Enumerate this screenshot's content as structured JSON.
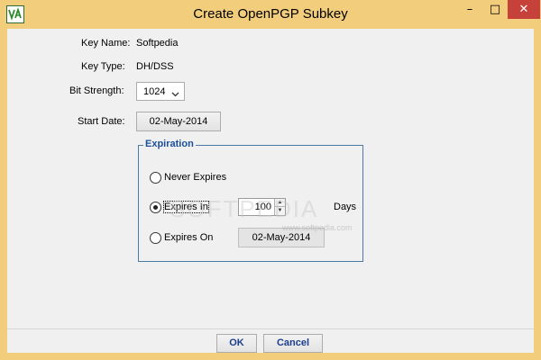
{
  "window": {
    "title": "Create OpenPGP Subkey",
    "minimize_glyph": "–",
    "maximize_glyph": "□",
    "close_glyph": "✕"
  },
  "form": {
    "key_name_label": "Key Name:",
    "key_name_value": "Softpedia",
    "key_type_label": "Key Type:",
    "key_type_value": "DH/DSS",
    "bit_strength_label": "Bit Strength:",
    "bit_strength_value": "1024",
    "start_date_label": "Start Date:",
    "start_date_value": "02-May-2014"
  },
  "expiration": {
    "legend": "Expiration",
    "never_label": "Never Expires",
    "expires_in_label": "Expires In",
    "expires_in_value": "100",
    "days_label": "Days",
    "expires_on_label": "Expires On",
    "expires_on_value": "02-May-2014",
    "selected": "expires_in"
  },
  "watermark": {
    "main": "SOFTPEDIA",
    "sub": "www.softpedia.com"
  },
  "buttons": {
    "ok": "OK",
    "cancel": "Cancel"
  },
  "colors": {
    "frame": "#f2cd7c",
    "client": "#f0f0f0",
    "close": "#c6413a",
    "accent_text": "#1b4f9c"
  }
}
